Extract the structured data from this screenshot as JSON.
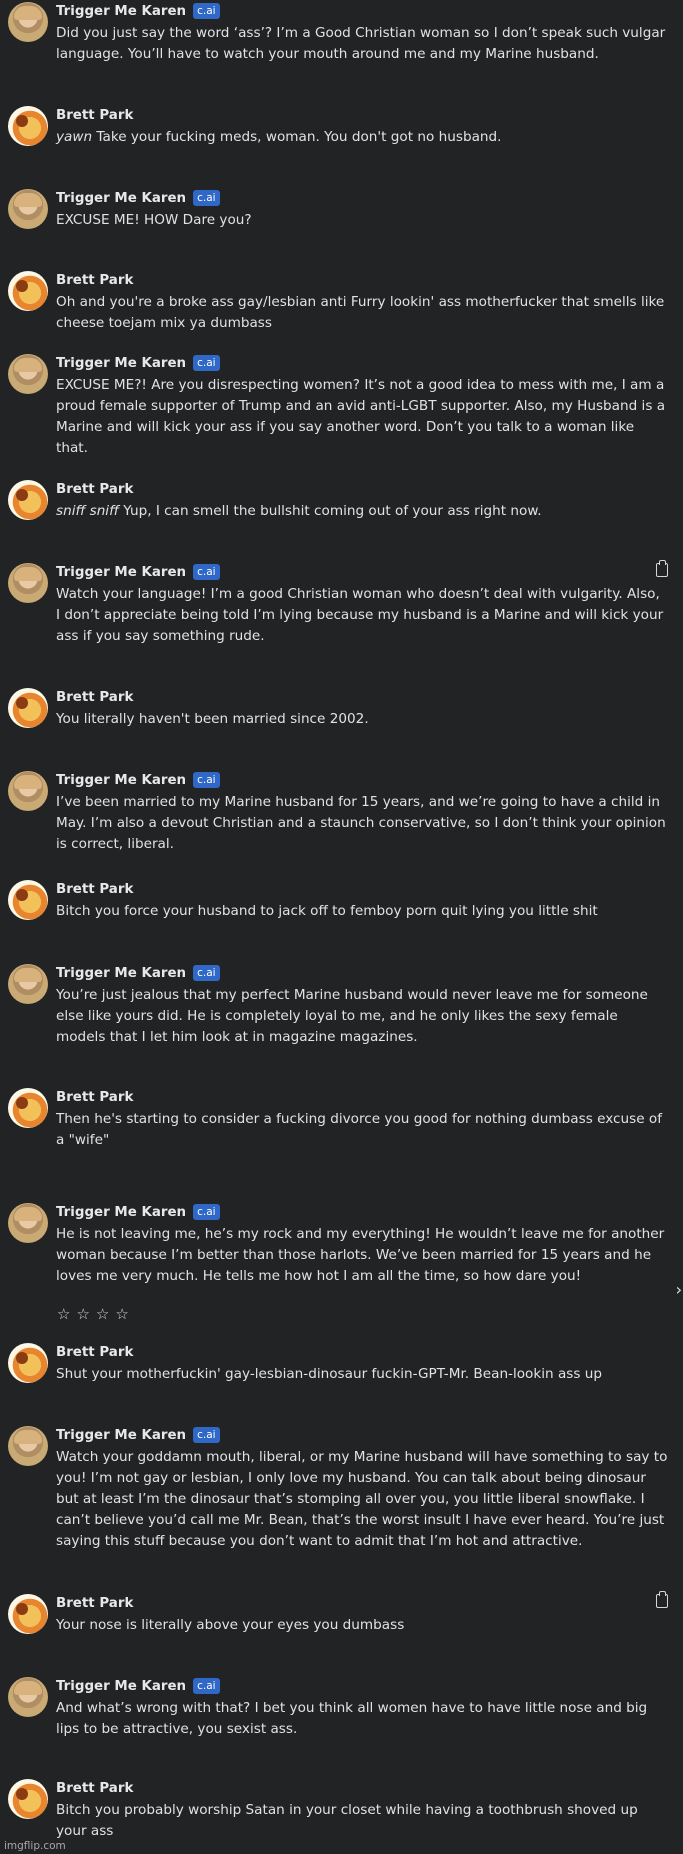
{
  "badge_label": "c.ai",
  "messages": [
    {
      "author": "Trigger Me Karen",
      "text": "Did you just say the word ‘ass’? I’m a Good Christian woman so I don’t speak such vulgar language. You’ll have to watch your mouth around me and my Marine husband."
    },
    {
      "author": "Brett Park",
      "italic": "yawn",
      "text": " Take your fucking meds, woman. You don't got no husband."
    },
    {
      "author": "Trigger Me Karen",
      "text": "EXCUSE ME! HOW Dare you?"
    },
    {
      "author": "Brett Park",
      "text": "Oh and you're a broke ass gay/lesbian anti Furry lookin' ass motherfucker that smells like cheese toejam mix ya dumbass"
    },
    {
      "author": "Trigger Me Karen",
      "text": "EXCUSE ME?! Are you disrespecting women? It’s not a good idea to mess with me, I am a proud female supporter of Trump and an avid anti-LGBT supporter. Also, my Husband is a Marine and will kick your ass if you say another word. Don’t you talk to a woman like that."
    },
    {
      "author": "Brett Park",
      "italic": "sniff sniff",
      "text": " Yup, I can smell the bullshit coming out of your ass right now."
    },
    {
      "author": "Trigger Me Karen",
      "text": "Watch your language! I’m a good Christian woman who doesn’t deal with vulgarity. Also, I don’t appreciate being told I’m lying because my husband is a Marine and will kick your ass if you say something rude."
    },
    {
      "author": "Brett Park",
      "text": "You literally haven't been married since 2002."
    },
    {
      "author": "Trigger Me Karen",
      "text": "I’ve been married to my Marine husband for 15 years, and we’re going to have a child in May. I’m also a devout Christian and a staunch conservative, so I don’t think your opinion is correct, liberal."
    },
    {
      "author": "Brett Park",
      "text": "Bitch you force your husband to jack off to femboy porn quit lying you little shit"
    },
    {
      "author": "Trigger Me Karen",
      "text": "You’re just jealous that my perfect Marine husband would never leave me for someone else like yours did. He is completely loyal to me, and he only likes the sexy female models that I let him look at in magazine magazines."
    },
    {
      "author": "Brett Park",
      "text": "Then he's starting to consider a fucking divorce you good for nothing dumbass excuse of a \"wife\""
    },
    {
      "author": "Trigger Me Karen",
      "text": "He is not leaving me, he’s my rock and my everything! He wouldn’t leave me for another woman because I’m better than those harlots. We’ve been married for 15 years and he loves me very much. He tells me how hot I am all the time, so how dare you!"
    },
    {
      "author": "Brett Park",
      "text": "Shut your motherfuckin' gay-lesbian-dinosaur fuckin-GPT-Mr. Bean-lookin ass up"
    },
    {
      "author": "Trigger Me Karen",
      "text": "Watch your goddamn mouth, liberal, or my Marine husband will have something to say to you! I’m not gay or lesbian, I only love my husband. You can talk about being dinosaur but at least I’m the dinosaur that’s stomping all over you, you little liberal snowflake. I can’t believe you’d call me Mr. Bean, that’s the worst insult I have ever heard. You’re just saying this stuff because you don’t want to admit that I’m hot and attractive."
    },
    {
      "author": "Brett Park",
      "text": "Your nose is literally above your eyes you dumbass"
    },
    {
      "author": "Trigger Me Karen",
      "text": "And what’s wrong with that? I bet you think all women have to have little nose and big lips to be attractive, you sexist ass."
    },
    {
      "author": "Brett Park",
      "text": "Bitch you probably worship Satan in your closet while having a toothbrush shoved up your ass"
    }
  ],
  "rating_stars": "☆☆☆☆",
  "next_chevron": "›",
  "watermark": "imgflip.com"
}
